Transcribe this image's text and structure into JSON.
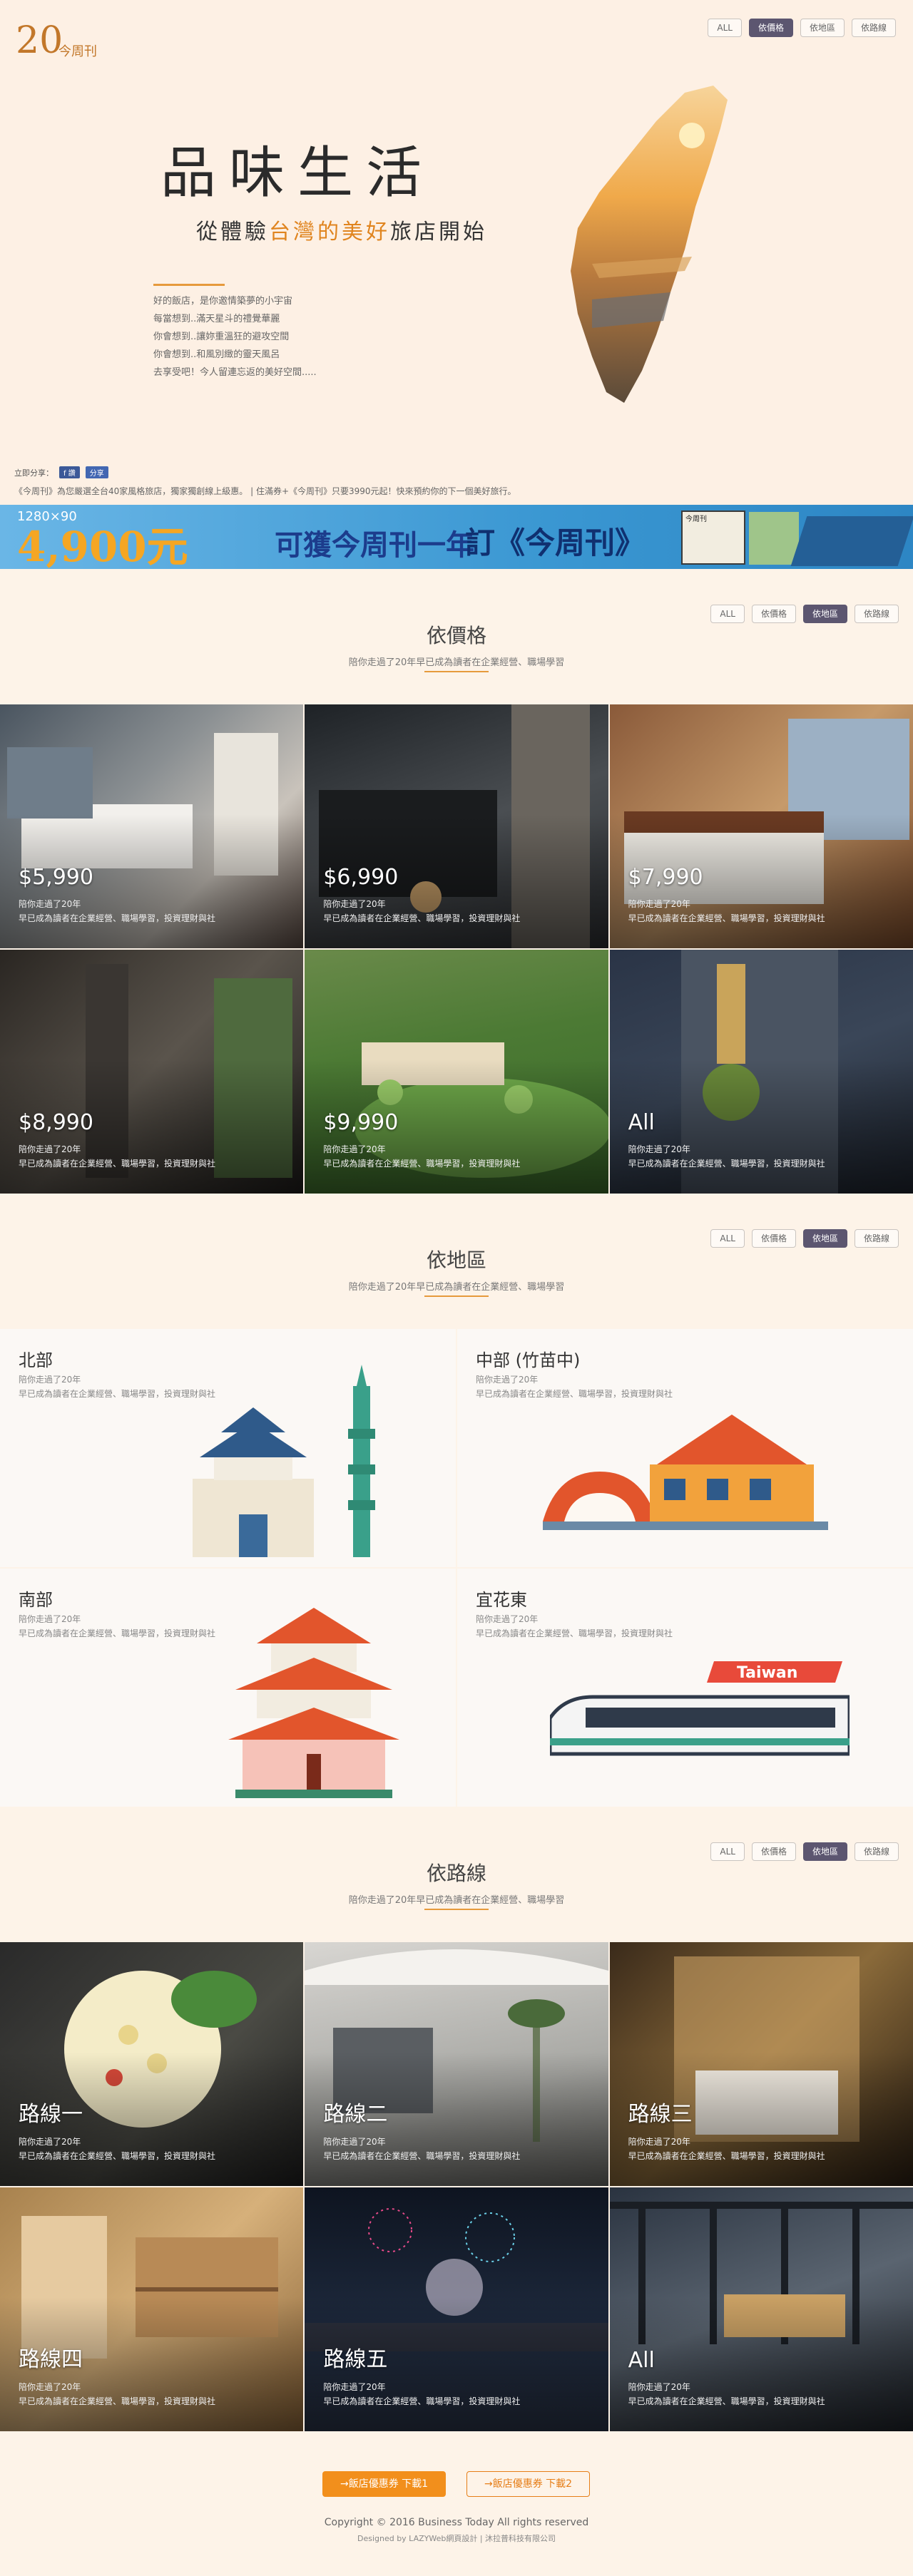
{
  "brand": {
    "logo_text": "20",
    "logo_sub": "今周刊"
  },
  "tabs": [
    "ALL",
    "依價格",
    "依地區",
    "依路線"
  ],
  "hero": {
    "title": "品味生活",
    "subtitle_pre": "從體驗",
    "subtitle_hl": "台灣的美好",
    "subtitle_post": "旅店開始",
    "desc": [
      "好的飯店，是你邀情築夢的小宇宙",
      "每當想到..滿天星斗的禮覺華麗",
      "你會想到..讓妳重溫狂的避攻空間",
      "你會想到..和風別緻的靈天風呂",
      "去享受吧！今人留連忘返的美好空間....."
    ]
  },
  "share": {
    "label": "立即分享：",
    "fb": "f 讚",
    "share_btn": "分享"
  },
  "notice": "《今周刊》為您嚴選全台40家風格旅店，獨家獨創線上級惠。  |   住滿券+《今周刊》只要3990元起！快來預約你的下一個美好旅行。",
  "banner": {
    "dim": "1280×90",
    "amount": "4,900元",
    "text1": "可獲今周刊一年",
    "text2": "訂《今周刊》",
    "mag_text": "今周刊"
  },
  "price": {
    "title": "依價格",
    "sub": "陪你走過了20年早已成為讀者在企業經營、職場學習",
    "cards": [
      {
        "label": "$5,990",
        "d1": "陪你走過了20年",
        "d2": "早已成為讀者在企業經營、職場學習，投資理財與社"
      },
      {
        "label": "$6,990",
        "d1": "陪你走過了20年",
        "d2": "早已成為讀者在企業經營、職場學習，投資理財與社"
      },
      {
        "label": "$7,990",
        "d1": "陪你走過了20年",
        "d2": "早已成為讀者在企業經營、職場學習，投資理財與社"
      },
      {
        "label": "$8,990",
        "d1": "陪你走過了20年",
        "d2": "早已成為讀者在企業經營、職場學習，投資理財與社"
      },
      {
        "label": "$9,990",
        "d1": "陪你走過了20年",
        "d2": "早已成為讀者在企業經營、職場學習，投資理財與社"
      },
      {
        "label": "All",
        "d1": "陪你走過了20年",
        "d2": "早已成為讀者在企業經營、職場學習，投資理財與社"
      }
    ]
  },
  "region": {
    "title": "依地區",
    "sub": "陪你走過了20年早已成為讀者在企業經營、職場學習",
    "cards": [
      {
        "label": "北部",
        "d1": "陪你走過了20年",
        "d2": "早已成為讀者在企業經營、職場學習，投資理財與社"
      },
      {
        "label": "中部 (竹苗中)",
        "d1": "陪你走過了20年",
        "d2": "早已成為讀者在企業經營、職場學習，投資理財與社"
      },
      {
        "label": "南部",
        "d1": "陪你走過了20年",
        "d2": "早已成為讀者在企業經營、職場學習，投資理財與社"
      },
      {
        "label": "宜花東",
        "d1": "陪你走過了20年",
        "d2": "早已成為讀者在企業經營、職場學習，投資理財與社",
        "train_text": "Taiwan"
      }
    ]
  },
  "route": {
    "title": "依路線",
    "sub": "陪你走過了20年早已成為讀者在企業經營、職場學習",
    "cards": [
      {
        "label": "路線一",
        "d1": "陪你走過了20年",
        "d2": "早已成為讀者在企業經營、職場學習，投資理財與社"
      },
      {
        "label": "路線二",
        "d1": "陪你走過了20年",
        "d2": "早已成為讀者在企業經營、職場學習，投資理財與社"
      },
      {
        "label": "路線三",
        "d1": "陪你走過了20年",
        "d2": "早已成為讀者在企業經營、職場學習，投資理財與社"
      },
      {
        "label": "路線四",
        "d1": "陪你走過了20年",
        "d2": "早已成為讀者在企業經營、職場學習，投資理財與社"
      },
      {
        "label": "路線五",
        "d1": "陪你走過了20年",
        "d2": "早已成為讀者在企業經營、職場學習，投資理財與社"
      },
      {
        "label": "All",
        "d1": "陪你走過了20年",
        "d2": "早已成為讀者在企業經營、職場學習，投資理財與社"
      }
    ]
  },
  "footer": {
    "btn1": "→飯店優惠券 下載1",
    "btn2": "→飯店優惠券 下載2",
    "copyright": "Copyright © 2016 Business Today All rights reserved",
    "designed": "Designed by LAZYWeb網頁設計 | 沐拉普科技有限公司"
  },
  "colors": {
    "accent": "#e69a3c",
    "active_tab": "#5c5670",
    "banner_blue": "#3a97d2"
  }
}
